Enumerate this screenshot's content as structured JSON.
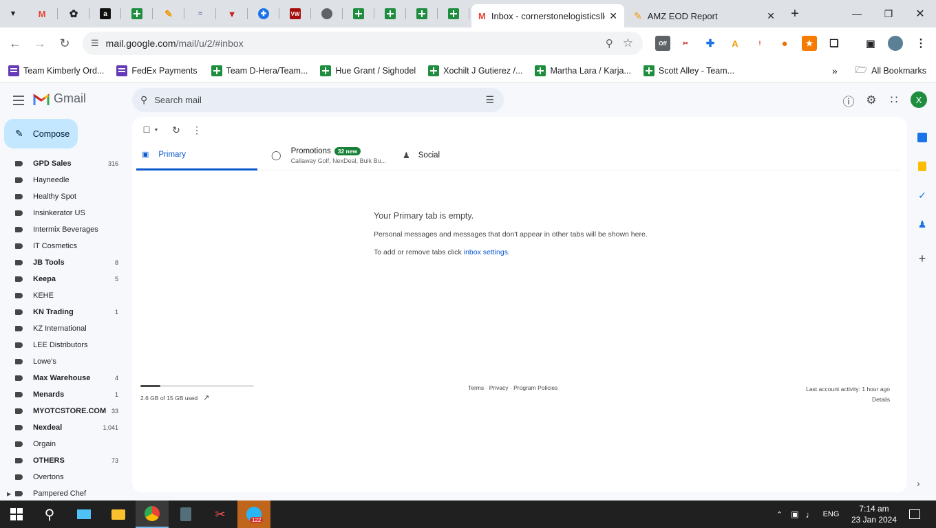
{
  "browser": {
    "pinned_tabs": [
      "gmail-icon",
      "openai-icon",
      "amazon-icon",
      "sheets-icon",
      "tool-icon",
      "wavy-icon",
      "triangle-icon",
      "dots-icon",
      "vw-icon",
      "globe-icon",
      "sheets-icon",
      "sheets-icon",
      "sheets-icon",
      "sheets-icon"
    ],
    "active_tab_title": "Inbox - cornerstonelogisticsllc",
    "second_tab_title": "AMZ EOD Report",
    "url_host": "mail.google.com",
    "url_path": "/mail/u/2/#inbox",
    "ext_off_label": "Off",
    "bookmarks": [
      {
        "label": "Team Kimberly Ord...",
        "icon": "forms-icon"
      },
      {
        "label": "FedEx Payments",
        "icon": "forms-icon"
      },
      {
        "label": "Team D-Hera/Team...",
        "icon": "sheets-icon"
      },
      {
        "label": "Hue Grant / Sighodel",
        "icon": "sheets-icon"
      },
      {
        "label": "Xochilt J Gutierez /...",
        "icon": "sheets-icon"
      },
      {
        "label": "Martha Lara / Karja...",
        "icon": "sheets-icon"
      },
      {
        "label": "Scott Alley - Team...",
        "icon": "sheets-icon"
      }
    ],
    "all_bookmarks": "All Bookmarks"
  },
  "gmail": {
    "logo_text": "Gmail",
    "search_placeholder": "Search mail",
    "avatar_letter": "X",
    "compose_label": "Compose",
    "labels": [
      {
        "name": "GPD Sales",
        "count": "316",
        "bold": true
      },
      {
        "name": "Hayneedle",
        "count": "",
        "bold": false
      },
      {
        "name": "Healthy Spot",
        "count": "",
        "bold": false
      },
      {
        "name": "Insinkerator US",
        "count": "",
        "bold": false
      },
      {
        "name": "Intermix Beverages",
        "count": "",
        "bold": false
      },
      {
        "name": "IT Cosmetics",
        "count": "",
        "bold": false
      },
      {
        "name": "JB Tools",
        "count": "8",
        "bold": true
      },
      {
        "name": "Keepa",
        "count": "5",
        "bold": true
      },
      {
        "name": "KEHE",
        "count": "",
        "bold": false
      },
      {
        "name": "KN Trading",
        "count": "1",
        "bold": true
      },
      {
        "name": "KZ International",
        "count": "",
        "bold": false
      },
      {
        "name": "LEE Distributors",
        "count": "",
        "bold": false
      },
      {
        "name": "Lowe's",
        "count": "",
        "bold": false
      },
      {
        "name": "Max Warehouse",
        "count": "4",
        "bold": true
      },
      {
        "name": "Menards",
        "count": "1",
        "bold": true
      },
      {
        "name": "MYOTCSTORE.COM",
        "count": "33",
        "bold": true
      },
      {
        "name": "Nexdeal",
        "count": "1,041",
        "bold": true
      },
      {
        "name": "Orgain",
        "count": "",
        "bold": false
      },
      {
        "name": "OTHERS",
        "count": "73",
        "bold": true
      },
      {
        "name": "Overtons",
        "count": "",
        "bold": false
      },
      {
        "name": "Pampered Chef",
        "count": "",
        "bold": false
      }
    ],
    "tabs": {
      "primary": "Primary",
      "promotions": "Promotions",
      "promotions_badge": "32 new",
      "promotions_sub": "Callaway Golf, NexDeal, Bulk Bu...",
      "social": "Social"
    },
    "empty": {
      "title": "Your Primary tab is empty.",
      "line1": "Personal messages and messages that don't appear in other tabs will be shown here.",
      "line2_prefix": "To add or remove tabs click ",
      "line2_link": "inbox settings",
      "line2_suffix": "."
    },
    "storage": {
      "text": "2.6 GB of 15 GB used",
      "fraction": 0.173
    },
    "footer": {
      "links": "Terms · Privacy · Program Policies",
      "activity": "Last account activity: 1 hour ago",
      "details": "Details"
    }
  },
  "taskbar": {
    "telegram_badge": "122",
    "lang": "ENG",
    "time": "7:14 am",
    "date": "23 Jan 2024"
  },
  "colors": {
    "accent": "#0b57d0",
    "compose_bg": "#c2e7ff",
    "badge_green": "#188038"
  }
}
